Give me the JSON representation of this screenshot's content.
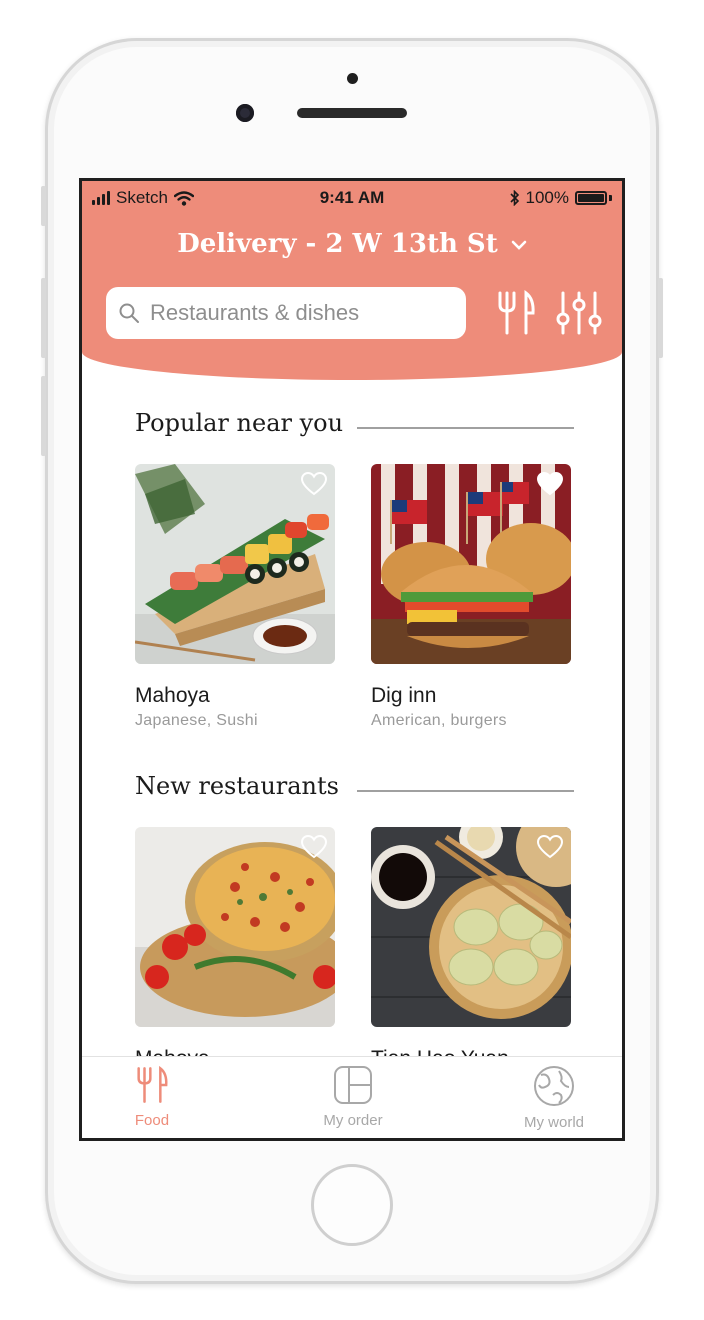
{
  "status_bar": {
    "carrier": "Sketch",
    "time": "9:41 AM",
    "battery": "100%"
  },
  "header": {
    "title": "Delivery - 2 W 13th St",
    "search_placeholder": "Restaurants & dishes",
    "accent_color": "#ee8c7a"
  },
  "sections": [
    {
      "title": "Popular near you",
      "cards": [
        {
          "name": "Mahoya",
          "subtitle": "Japanese, Sushi",
          "favorited": false,
          "image": "sushi-platter"
        },
        {
          "name": "Dig inn",
          "subtitle": "American, burgers",
          "favorited": true,
          "image": "burgers-with-flags"
        }
      ]
    },
    {
      "title": "New restaurants",
      "cards": [
        {
          "name": "Mahoya",
          "subtitle": "",
          "favorited": false,
          "image": "pizza"
        },
        {
          "name": "Tian Hao Yuan",
          "subtitle": "",
          "favorited": false,
          "image": "dumplings"
        }
      ]
    }
  ],
  "tabs": [
    {
      "label": "Food",
      "icon": "fork-knife-icon",
      "active": true
    },
    {
      "label": "My order",
      "icon": "order-icon",
      "active": false
    },
    {
      "label": "My world",
      "icon": "globe-icon",
      "active": false
    }
  ]
}
